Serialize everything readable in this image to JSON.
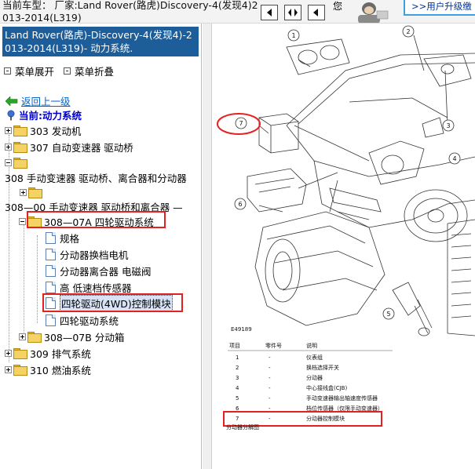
{
  "topbar": {
    "car_label": "当前车型：  厂家:Land Rover(路虎)Discovery-4(发现4)2013-2014(L319)",
    "nav_buttons": [
      "prev-icon",
      "expand-icon",
      "back-icon"
    ],
    "upgrade_fragment": "您",
    "upgrade_link": ">>用户升级缴"
  },
  "left": {
    "title": "Land Rover(路虎)-Discovery-4(发现4)-2013-2014(L319)- 动力系统.",
    "expand_all": "菜单展开",
    "collapse_all": "菜单折叠",
    "back_link": "返回上一级",
    "current_label": "当前:动力系统",
    "tree": {
      "n303": "303 发动机",
      "n307": "307 自动变速器 驱动桥",
      "n308_line": "308 手动变速器 驱动桥、离合器和分动器",
      "n308_00": "308—00 手动变速器 驱动桥和离合器 —",
      "n308_07a": "308—07A 四轮驱动系统",
      "leaf_1": "规格",
      "leaf_2": "分动器换档电机",
      "leaf_3": "分动器离合器 电磁阀",
      "leaf_4": "高 低速档传感器",
      "leaf_5": "四轮驱动(4WD)控制模块",
      "leaf_6": "四轮驱动系统",
      "n308_07b": "308—07B 分动箱",
      "n309": "309 排气系统",
      "n310": "310 燃油系统"
    }
  },
  "diagram": {
    "figure_id": "E49189",
    "callouts": [
      "1",
      "2",
      "3",
      "4",
      "5",
      "6",
      "7"
    ],
    "legend": {
      "headers": [
        "项目",
        "零件号",
        "说明"
      ],
      "rows": [
        {
          "item": "1",
          "part": "-",
          "desc": "仪表组"
        },
        {
          "item": "2",
          "part": "-",
          "desc": "换档选择开关"
        },
        {
          "item": "3",
          "part": "-",
          "desc": "分动器"
        },
        {
          "item": "4",
          "part": "-",
          "desc": "中心接线盒(CJB)"
        },
        {
          "item": "5",
          "part": "-",
          "desc": "手动变速器输出轴速度传感器"
        },
        {
          "item": "6",
          "part": "-",
          "desc": "档位传感器（仅限手动变速器）"
        },
        {
          "item": "7",
          "part": "-",
          "desc": "分动器控制模块"
        }
      ],
      "footer": "分动器分解图"
    }
  },
  "colors": {
    "title_bg": "#1c5d9a",
    "highlight_red": "#e62020",
    "link_blue": "#0066cc",
    "upgrade_border": "#3aa0e0"
  }
}
